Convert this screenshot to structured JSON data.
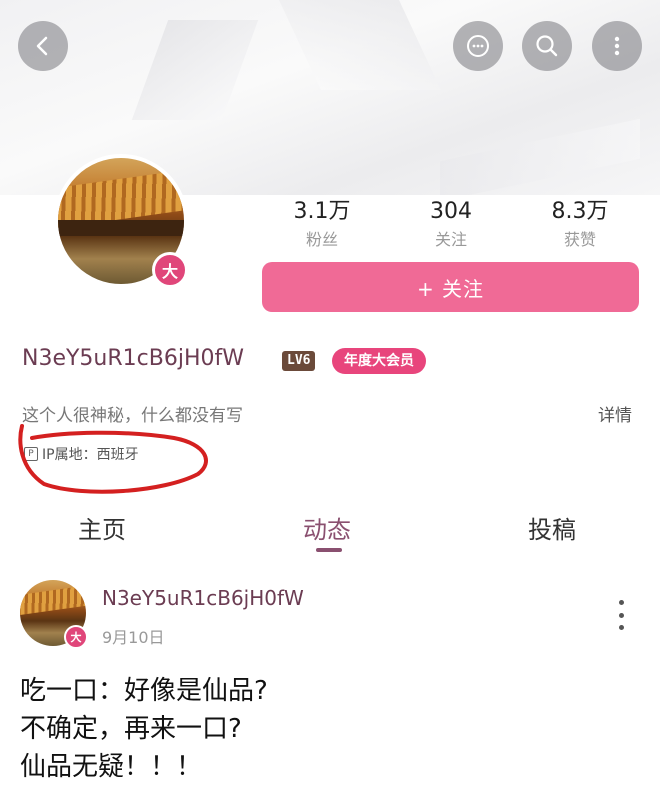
{
  "header": {
    "back_icon": "chevron-left-icon",
    "chat_icon": "chat-icon",
    "search_icon": "search-icon",
    "more_icon": "more-vertical-icon"
  },
  "profile": {
    "avatar_badge": "大",
    "stats": [
      {
        "value": "3.1万",
        "label": "粉丝"
      },
      {
        "value": "304",
        "label": "关注"
      },
      {
        "value": "8.3万",
        "label": "获赞"
      }
    ],
    "follow_label": "+ 关注",
    "username": "N3eY5uR1cB6jH0fW",
    "level_badge": "LV6",
    "vip_badge": "年度大会员",
    "bio": "这个人很神秘，什么都没有写",
    "detail_link": "详情",
    "ip_location": "IP属地：西班牙"
  },
  "tabs": [
    {
      "label": "主页"
    },
    {
      "label": "动态"
    },
    {
      "label": "投稿"
    }
  ],
  "post": {
    "author": "N3eY5uR1cB6jH0fW",
    "date": "9月10日",
    "avatar_badge": "大",
    "lines": [
      "吃一口：好像是仙品?",
      "不确定，再来一口?",
      "仙品无疑！！！"
    ]
  },
  "colors": {
    "accent": "#f06a96",
    "vip": "#e8457c",
    "username": "#6b3c52",
    "annotation": "#d42020"
  }
}
